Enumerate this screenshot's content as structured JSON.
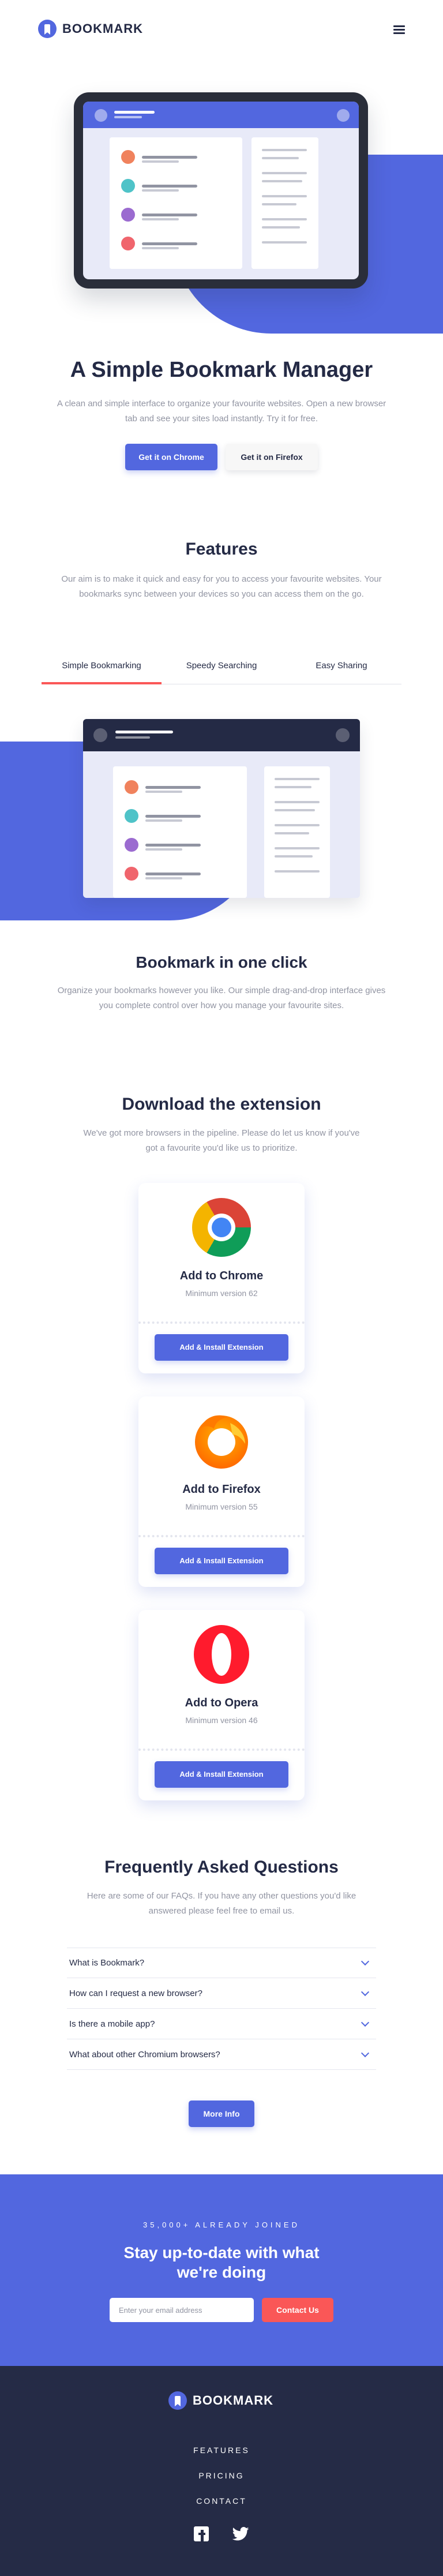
{
  "header": {
    "brand": "BOOKMARK"
  },
  "hero": {
    "title": "A Simple Bookmark Manager",
    "subtitle": "A clean and simple interface to organize your favourite websites. Open a new browser tab and see your sites load instantly. Try it for free.",
    "primary_button": "Get it on Chrome",
    "secondary_button": "Get it on Firefox"
  },
  "features": {
    "title": "Features",
    "subtitle": "Our aim is to make it quick and easy for you to access your favourite websites. Your bookmarks sync between your devices so you can access them on the go.",
    "tabs": [
      {
        "label": "Simple Bookmarking",
        "active": true
      },
      {
        "label": "Speedy Searching",
        "active": false
      },
      {
        "label": "Easy Sharing",
        "active": false
      }
    ],
    "active_title": "Bookmark in one click",
    "active_text": "Organize your bookmarks however you like. Our simple drag-and-drop interface gives you complete control over how you manage your favourite sites."
  },
  "download": {
    "title": "Download the extension",
    "subtitle": "We've got more browsers in the pipeline. Please do let us know if you've got a favourite you'd like us to prioritize.",
    "cards": [
      {
        "name": "Add to Chrome",
        "version": "Minimum version 62",
        "button": "Add & Install Extension",
        "icon": "chrome-icon"
      },
      {
        "name": "Add to Firefox",
        "version": "Minimum version 55",
        "button": "Add & Install Extension",
        "icon": "firefox-icon"
      },
      {
        "name": "Add to Opera",
        "version": "Minimum version 46",
        "button": "Add & Install Extension",
        "icon": "opera-icon"
      }
    ]
  },
  "faq": {
    "title": "Frequently Asked Questions",
    "subtitle": "Here are some of our FAQs. If you have any other questions you'd like answered please feel free to email us.",
    "items": [
      {
        "question": "What is Bookmark?"
      },
      {
        "question": "How can I request a new browser?"
      },
      {
        "question": "Is there a mobile app?"
      },
      {
        "question": "What about other Chromium browsers?"
      }
    ],
    "more_button": "More Info"
  },
  "contact": {
    "pretitle": "35,000+ ALREADY JOINED",
    "title": "Stay up-to-date with what we're doing",
    "email_placeholder": "Enter your email address",
    "button": "Contact Us"
  },
  "footer": {
    "brand": "BOOKMARK",
    "links": [
      "FEATURES",
      "PRICING",
      "CONTACT"
    ],
    "socials": [
      "facebook-icon",
      "twitter-icon"
    ]
  },
  "colors": {
    "primary": "#5267df",
    "secondary": "#fa5757",
    "dark": "#242a45",
    "grey": "#9194a2",
    "footer_bg": "#252b46"
  }
}
